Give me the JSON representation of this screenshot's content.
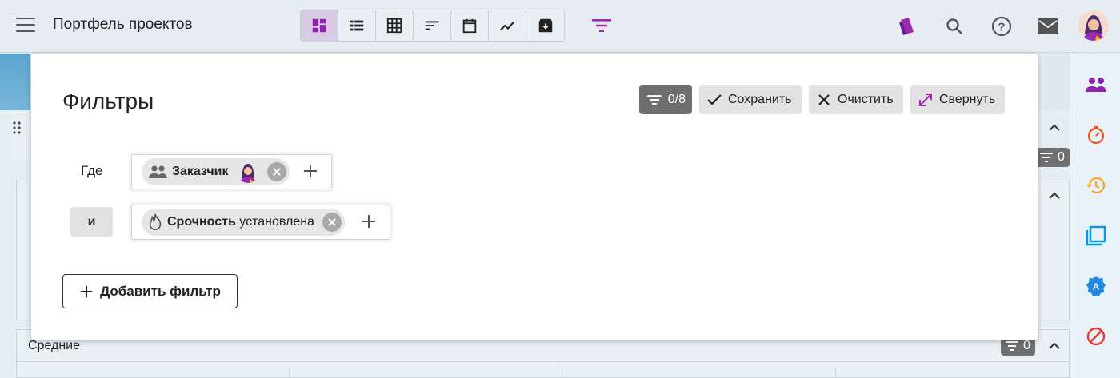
{
  "header": {
    "title": "Портфель проектов",
    "views": [
      {
        "icon": "dashboard-icon"
      },
      {
        "icon": "list-icon"
      },
      {
        "icon": "grid-icon"
      },
      {
        "icon": "sort-icon"
      },
      {
        "icon": "calendar-icon"
      },
      {
        "icon": "chart-line-icon"
      },
      {
        "icon": "archive-icon"
      }
    ],
    "accent": "#9c27b0"
  },
  "background": {
    "section_label": "Средние",
    "filter_badge_count": "0",
    "filter_badge_count_2": "0"
  },
  "modal": {
    "title": "Фильтры",
    "counter": "0/8",
    "save_label": "Сохранить",
    "clear_label": "Очистить",
    "collapse_label": "Свернуть",
    "where_label": "Где",
    "and_label": "и",
    "conditions": [
      {
        "field": "Заказчик",
        "value": ""
      },
      {
        "field": "Срочность",
        "value": "установлена"
      }
    ],
    "add_filter_label": "Добавить фильтр"
  },
  "sidebar": {
    "icons": [
      "people-icon",
      "timer-icon",
      "history-icon",
      "square-icon",
      "badge-a-icon",
      "block-icon"
    ]
  }
}
